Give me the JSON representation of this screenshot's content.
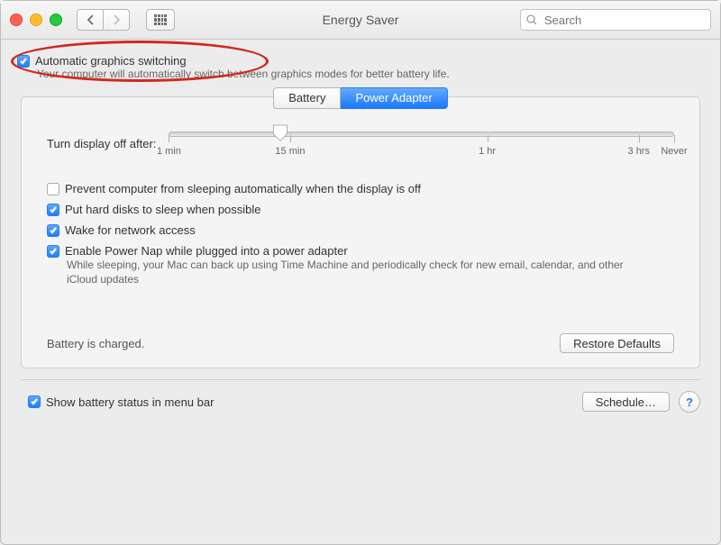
{
  "window": {
    "title": "Energy Saver",
    "search_placeholder": "Search"
  },
  "top": {
    "auto_gfx_label": "Automatic graphics switching",
    "auto_gfx_checked": true,
    "auto_gfx_hint": "Your computer will automatically switch between graphics modes for better battery life."
  },
  "tabs": {
    "battery": "Battery",
    "power_adapter": "Power Adapter",
    "active": "power_adapter"
  },
  "slider": {
    "label": "Turn display off after:",
    "ticks": [
      {
        "pos": 0.0,
        "label": "1 min"
      },
      {
        "pos": 0.24,
        "label": "15 min"
      },
      {
        "pos": 0.63,
        "label": "1 hr"
      },
      {
        "pos": 0.93,
        "label": "3 hrs"
      },
      {
        "pos": 1.0,
        "label": "Never"
      }
    ],
    "value_pos": 0.22
  },
  "options": [
    {
      "key": "prevent_sleep",
      "checked": false,
      "label": "Prevent computer from sleeping automatically when the display is off"
    },
    {
      "key": "hdd_sleep",
      "checked": true,
      "label": "Put hard disks to sleep when possible"
    },
    {
      "key": "wake_network",
      "checked": true,
      "label": "Wake for network access"
    },
    {
      "key": "power_nap",
      "checked": true,
      "label": "Enable Power Nap while plugged into a power adapter",
      "hint": "While sleeping, your Mac can back up using Time Machine and periodically check for new email, calendar, and other iCloud updates"
    }
  ],
  "panel_foot": {
    "status": "Battery is charged.",
    "restore": "Restore Defaults"
  },
  "footer": {
    "menu_bar_label": "Show battery status in menu bar",
    "menu_bar_checked": true,
    "schedule": "Schedule…"
  }
}
